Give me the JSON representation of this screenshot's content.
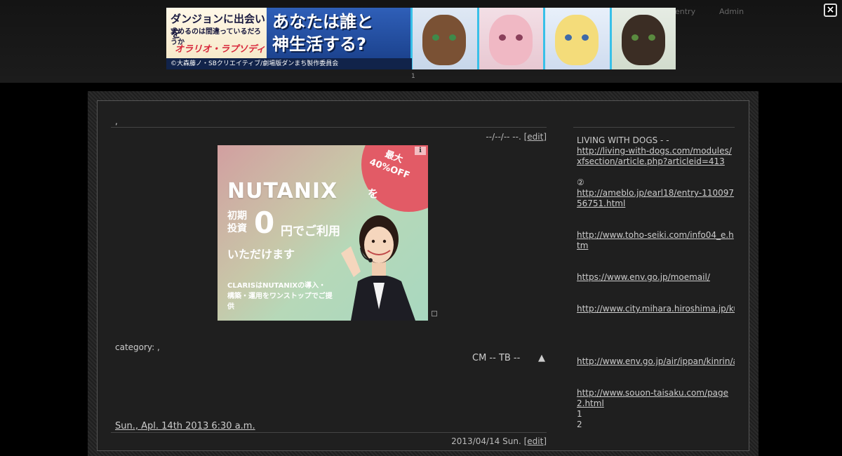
{
  "header": {
    "nav": [
      {
        "label": "entry"
      },
      {
        "label": "Admin"
      }
    ],
    "close_label": "×",
    "pager": "1"
  },
  "banner_ad": {
    "title_line1": "ダンジョンに出会いを",
    "title_line2": "求めるのは間違っているだろうか",
    "subtitle": "オラリオ・ラプソディア",
    "catch_line1": "あなたは誰と",
    "catch_line2": "神生活する?",
    "copyright": "©大森藤ノ・SBクリエイティブ/劇場版ダンまち製作委員会",
    "accent_color": "#38c0e8"
  },
  "entry1": {
    "title": ",",
    "date_text": "--/--/-- --. ",
    "edit_label": "[edit]",
    "category_label": "category: ,",
    "cm_tb": "CM -- TB --",
    "up_arrow": "▲"
  },
  "content_ad": {
    "discount_line1": "最大",
    "discount_line2": "40%OFF",
    "info_icon": "ℹ",
    "brand": "NUTANIX",
    "brand_suffix": "を",
    "line2a": "初期",
    "line2b": "投資",
    "zero": "0",
    "zero_suffix": "円でご利用",
    "line3": "いただけます",
    "line4": "CLARISはNUTANIXの導入・構築・運用をワンストップでご提供"
  },
  "entry2": {
    "title": "Sun., Apl. 14th 2013 6:30 a.m.",
    "date_text": "2013/04/14 Sun. ",
    "edit_label": "[edit]"
  },
  "sidebar": {
    "heading": "LIVING WITH DOGS - -",
    "links": [
      "http://living-with-dogs.com/modules/xfsection/article.php?articleid=413",
      "http://ameblo.jp/earl18/entry-11009756751.html",
      "http://www.toho-seiki.com/info04_e.htm",
      "https://www.env.go.jp/moemail/",
      "http://www.city.mihara.hiroshima.jp/kurashi/",
      "http://www.env.go.jp/air/ippan/kinrin/a",
      "http://www.souon-taisaku.com/page2.html"
    ],
    "circled_two": "②",
    "item_1": "1",
    "item_2": "2"
  }
}
